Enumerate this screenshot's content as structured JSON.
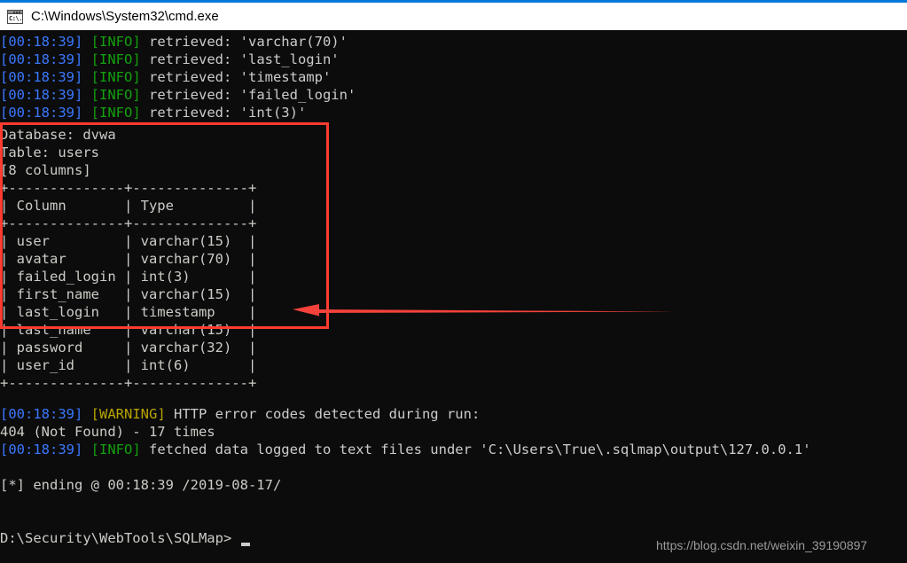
{
  "window": {
    "title": "C:\\Windows\\System32\\cmd.exe",
    "icon_name": "cmd-console-icon",
    "icon_glyph": "C:\\.",
    "accent_color": "#0078d7",
    "titlebar_bg": "#ffffff",
    "console_bg": "#0c0c0c"
  },
  "colors": {
    "timestamp": "#3b78ff",
    "info": "#13a10e",
    "warning": "#b9a400",
    "text": "#cccccc",
    "annotation_red": "#ff3b30"
  },
  "console": {
    "retrieved_lines": [
      {
        "time": "[00:18:39]",
        "level": "[INFO]",
        "message": " retrieved: 'varchar(70)'"
      },
      {
        "time": "[00:18:39]",
        "level": "[INFO]",
        "message": " retrieved: 'last_login'"
      },
      {
        "time": "[00:18:39]",
        "level": "[INFO]",
        "message": " retrieved: 'timestamp'"
      },
      {
        "time": "[00:18:39]",
        "level": "[INFO]",
        "message": " retrieved: 'failed_login'"
      },
      {
        "time": "[00:18:39]",
        "level": "[INFO]",
        "message": " retrieved: 'int(3)'"
      }
    ],
    "result_header": {
      "database": "Database: dvwa",
      "table": "Table: users",
      "column_count": "[8 columns]"
    },
    "table": {
      "rule": "+--------------+--------------+",
      "header_row": "| Column       | Type         |",
      "headers": [
        "Column",
        "Type"
      ],
      "rows": [
        {
          "line": "| user         | varchar(15)  |",
          "column": "user",
          "type": "varchar(15)"
        },
        {
          "line": "| avatar       | varchar(70)  |",
          "column": "avatar",
          "type": "varchar(70)"
        },
        {
          "line": "| failed_login | int(3)       |",
          "column": "failed_login",
          "type": "int(3)"
        },
        {
          "line": "| first_name   | varchar(15)  |",
          "column": "first_name",
          "type": "varchar(15)"
        },
        {
          "line": "| last_login   | timestamp    |",
          "column": "last_login",
          "type": "timestamp"
        },
        {
          "line": "| last_name    | varchar(15)  |",
          "column": "last_name",
          "type": "varchar(15)"
        },
        {
          "line": "| password     | varchar(32)  |",
          "column": "password",
          "type": "varchar(32)"
        },
        {
          "line": "| user_id      | int(6)       |",
          "column": "user_id",
          "type": "int(6)"
        }
      ]
    },
    "footer_lines": {
      "warning_time": "[00:18:39]",
      "warning_level": "[WARNING]",
      "warning_message": " HTTP error codes detected during run:",
      "error_detail": "404 (Not Found) - 17 times",
      "fetched_time": "[00:18:39]",
      "fetched_level": "[INFO]",
      "fetched_message": " fetched data logged to text files under 'C:\\Users\\True\\.sqlmap\\output\\127.0.0.1'",
      "ending": "[*] ending @ 00:18:39 /2019-08-17/"
    },
    "prompt": "D:\\Security\\WebTools\\SQLMap>"
  },
  "annotations": {
    "highlight_box_label": "result-table-highlight",
    "arrow_label": "pointer-arrow-to-table"
  },
  "watermark": "https://blog.csdn.net/weixin_39190897"
}
